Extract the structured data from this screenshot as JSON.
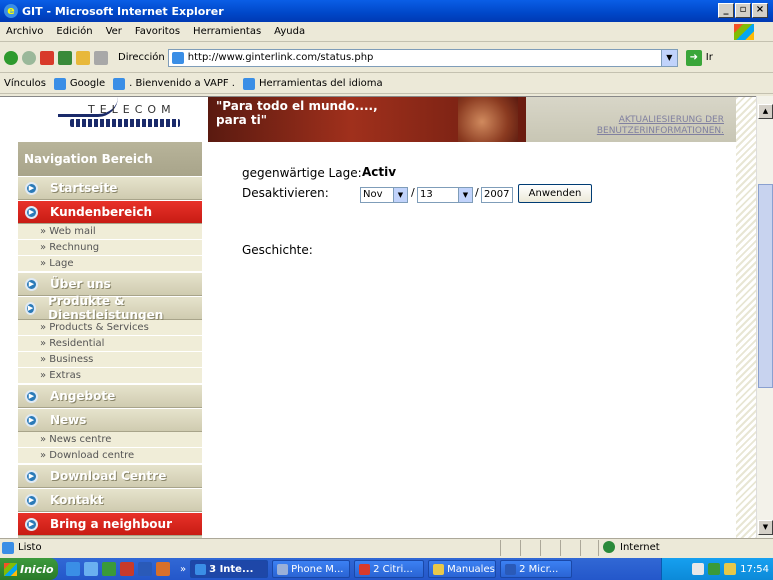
{
  "window": {
    "title": "GIT - Microsoft Internet Explorer",
    "min": "_",
    "max": "▫",
    "close": "×"
  },
  "menu": [
    "Archivo",
    "Edición",
    "Ver",
    "Favoritos",
    "Herramientas",
    "Ayuda"
  ],
  "address": {
    "label": "Dirección",
    "url": "http://www.ginterlink.com/status.php",
    "go": "Ir"
  },
  "links": {
    "label": "Vínculos",
    "items": [
      "Google",
      ". Bienvenido a VAPF .",
      "Herramientas del idioma"
    ]
  },
  "header": {
    "logo_text": "TELECOM",
    "banner_line1": "\"Para todo el mundo....,",
    "banner_line2": "para ti\"",
    "update_link_line1": "AKTUALIESIERUNG DER",
    "update_link_line2": "BENUTZERINFORMATIONEN."
  },
  "nav": {
    "heading": "Navigation Bereich",
    "items": [
      {
        "label": "Startseite"
      },
      {
        "label": "Kundenbereich",
        "active": true
      },
      {
        "label": "Über uns"
      },
      {
        "label": "Produkte & Dienstleistungen"
      },
      {
        "label": "Angebote"
      },
      {
        "label": "News"
      },
      {
        "label": "Download Centre"
      },
      {
        "label": "Kontakt"
      },
      {
        "label": "Bring a neighbour",
        "active": true
      }
    ],
    "sub_kunden": [
      "» Web mail",
      "» Rechnung",
      "» Lage"
    ],
    "sub_produkte": [
      "» Products & Services",
      "» Residential",
      "» Business",
      "» Extras"
    ],
    "sub_news": [
      "» News centre",
      "» Download centre"
    ]
  },
  "main": {
    "status_label": "gegenwärtige Lage:",
    "status_value": "Activ",
    "deactivate_label": "Desaktivieren:",
    "month": "Nov",
    "day": "13",
    "slash": "/",
    "year": "2007",
    "apply_button": "Anwenden",
    "history_label": "Geschichte:"
  },
  "statusbar": {
    "text": "Listo",
    "zone": "Internet"
  },
  "taskbar": {
    "start": "Inicio",
    "tasks": [
      "3 Inte...",
      "Phone M...",
      "2 Citri...",
      "Manuales",
      "2 Micr..."
    ],
    "tray_time": "17:54"
  },
  "colors": {
    "accent_red": "#d8261c",
    "sidebar": "#d6d3b8",
    "xp_blue": "#0a5ee6"
  }
}
